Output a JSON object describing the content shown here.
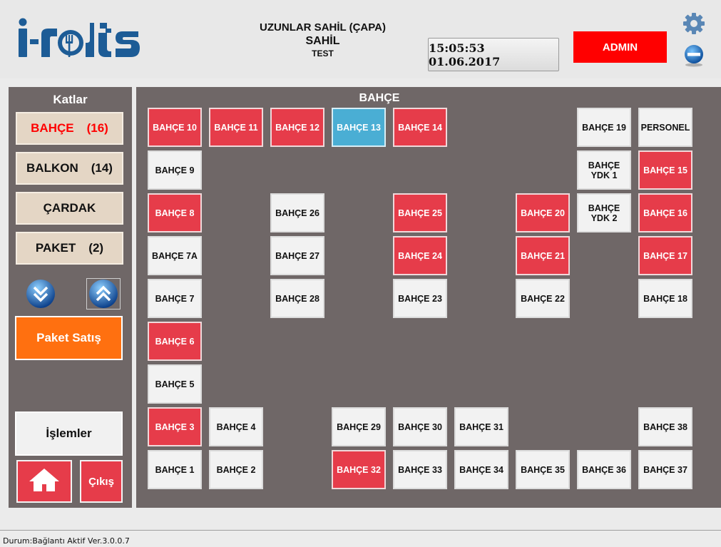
{
  "header": {
    "logo_text": "i-rots",
    "venue_line1": "UZUNLAR SAHİL (ÇAPA)",
    "venue_line2": "SAHİL",
    "venue_line3": "TEST",
    "clock": "15:05:53 01.06.2017",
    "user_button": "ADMIN",
    "icons": {
      "settings": "gear-icon",
      "minimize": "minus-circle-icon"
    },
    "colors": {
      "user_button": "#ff0000",
      "logo": "#1d5c96"
    }
  },
  "sidebar": {
    "title": "Katlar",
    "floors": [
      {
        "name": "BAHÇE",
        "count": "(16)",
        "active": true
      },
      {
        "name": "BALKON",
        "count": "(14)",
        "active": false
      },
      {
        "name": "ÇARDAK",
        "count": "",
        "active": false
      },
      {
        "name": "PAKET",
        "count": "(2)",
        "active": false
      }
    ],
    "scroll_icons": {
      "down": "double-chevron-down-icon",
      "up": "double-chevron-up-icon"
    },
    "paket_satis": "Paket Satış",
    "islemler": "İşlemler",
    "home_icon": "home-icon",
    "exit": "Çıkış",
    "colors": {
      "panel": "#6f6767",
      "floor_button": "#e4d6c5",
      "paket_satis": "#ff7010",
      "exit": "#e63c4a"
    }
  },
  "main": {
    "title": "BAHÇE",
    "legend_colors": {
      "free": "#f2f2f2",
      "occupied": "#e63c4a",
      "selected": "#4aaed4"
    },
    "tables": [
      {
        "label": "BAHÇE 10",
        "status": "occupied"
      },
      {
        "label": "BAHÇE 11",
        "status": "occupied"
      },
      {
        "label": "BAHÇE 12",
        "status": "occupied"
      },
      {
        "label": "BAHÇE 13",
        "status": "selected"
      },
      {
        "label": "BAHÇE 14",
        "status": "occupied"
      },
      {
        "label": "BAHÇE 19",
        "status": "free"
      },
      {
        "label": "PERSONEL",
        "status": "free"
      },
      {
        "label": "BAHÇE 9",
        "status": "free"
      },
      {
        "label": "BAHÇE\nYDK 1",
        "status": "free"
      },
      {
        "label": "BAHÇE 15",
        "status": "occupied"
      },
      {
        "label": "BAHÇE 8",
        "status": "occupied"
      },
      {
        "label": "BAHÇE 26",
        "status": "free"
      },
      {
        "label": "BAHÇE 25",
        "status": "occupied"
      },
      {
        "label": "BAHÇE 20",
        "status": "occupied"
      },
      {
        "label": "BAHÇE\nYDK 2",
        "status": "free"
      },
      {
        "label": "BAHÇE 16",
        "status": "occupied"
      },
      {
        "label": "BAHÇE 7A",
        "status": "free"
      },
      {
        "label": "BAHÇE 27",
        "status": "free"
      },
      {
        "label": "BAHÇE 24",
        "status": "occupied"
      },
      {
        "label": "BAHÇE 21",
        "status": "occupied"
      },
      {
        "label": "BAHÇE 17",
        "status": "occupied"
      },
      {
        "label": "BAHÇE 7",
        "status": "free"
      },
      {
        "label": "BAHÇE 28",
        "status": "free"
      },
      {
        "label": "BAHÇE 23",
        "status": "free"
      },
      {
        "label": "BAHÇE 22",
        "status": "free"
      },
      {
        "label": "BAHÇE 18",
        "status": "free"
      },
      {
        "label": "BAHÇE 6",
        "status": "occupied"
      },
      {
        "label": "BAHÇE 5",
        "status": "free"
      },
      {
        "label": "BAHÇE 3",
        "status": "occupied"
      },
      {
        "label": "BAHÇE 4",
        "status": "free"
      },
      {
        "label": "BAHÇE 29",
        "status": "free"
      },
      {
        "label": "BAHÇE 30",
        "status": "free"
      },
      {
        "label": "BAHÇE 31",
        "status": "free"
      },
      {
        "label": "BAHÇE 38",
        "status": "free"
      },
      {
        "label": "BAHÇE 1",
        "status": "free"
      },
      {
        "label": "BAHÇE 2",
        "status": "free"
      },
      {
        "label": "BAHÇE 32",
        "status": "occupied"
      },
      {
        "label": "BAHÇE 33",
        "status": "free"
      },
      {
        "label": "BAHÇE 34",
        "status": "free"
      },
      {
        "label": "BAHÇE 35",
        "status": "free"
      },
      {
        "label": "BAHÇE 36",
        "status": "free"
      },
      {
        "label": "BAHÇE 37",
        "status": "free"
      }
    ]
  },
  "status_bar": {
    "text": "Durum:Bağlantı Aktif Ver.3.0.0.7"
  }
}
